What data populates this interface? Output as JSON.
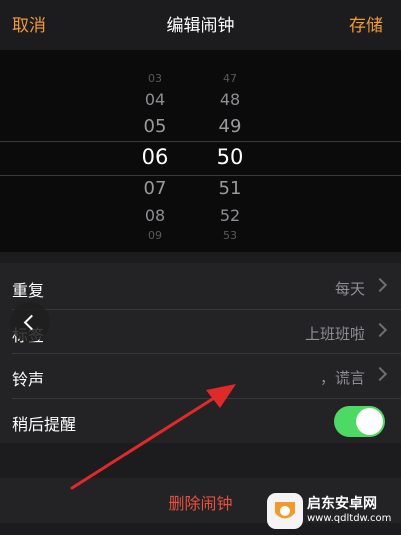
{
  "navbar": {
    "cancel_label": "取消",
    "title": "编辑闹钟",
    "save_label": "存储",
    "accent_color": "#f09a37"
  },
  "picker": {
    "hours": [
      "03",
      "04",
      "05",
      "06",
      "07",
      "08",
      "09"
    ],
    "minutes": [
      "47",
      "48",
      "49",
      "50",
      "51",
      "52",
      "53"
    ],
    "selected_hour": "06",
    "selected_minute": "50"
  },
  "settings": {
    "repeat": {
      "label": "重复",
      "value": "每天"
    },
    "tag": {
      "label": "标签",
      "value": "上班班啦"
    },
    "sound": {
      "label": "铃声",
      "value": "，谎言"
    },
    "snooze": {
      "label": "稍后提醒",
      "enabled": true,
      "toggle_color": "#4cd964"
    }
  },
  "delete": {
    "label": "删除闹钟",
    "color": "#e5503f"
  },
  "watermark": {
    "title": "启东安卓网",
    "url": "www.qdltdw.com"
  },
  "icons": [
    "chevron-right-icon",
    "back-arrow-icon",
    "annotation-arrow-icon",
    "watermark-logo-icon"
  ]
}
